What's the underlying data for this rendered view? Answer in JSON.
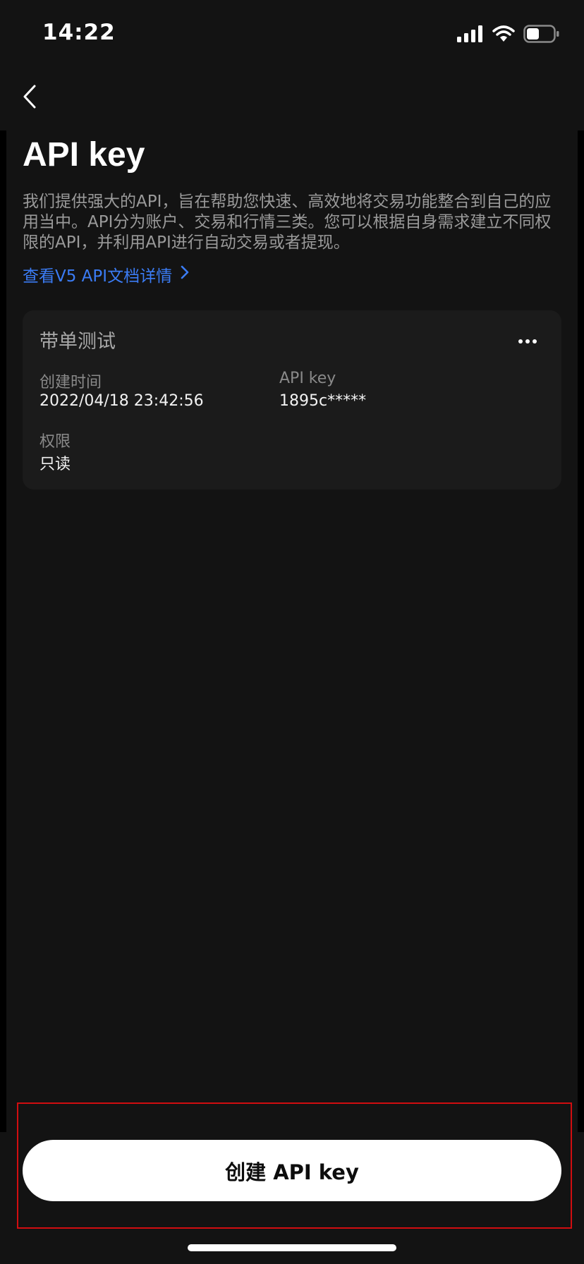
{
  "status_bar": {
    "time": "14:22"
  },
  "page": {
    "title": "API key",
    "description": "我们提供强大的API，旨在帮助您快速、高效地将交易功能整合到自己的应用当中。API分为账户、交易和行情三类。您可以根据自身需求建立不同权限的API，并利用API进行自动交易或者提现。",
    "doc_link": "查看V5 API文档详情"
  },
  "api_card": {
    "name": "带单测试",
    "created_label": "创建时间",
    "created_value": "2022/04/18 23:42:56",
    "key_label": "API key",
    "key_value": "1895c*****",
    "permission_label": "权限",
    "permission_value": "只读"
  },
  "actions": {
    "create_label": "创建 API key"
  },
  "colors": {
    "background": "#131313",
    "card": "#1b1b1b",
    "link": "#3b7cf5",
    "highlight_border": "#d10d10",
    "button": "#ffffff"
  },
  "icons": [
    "back-arrow-icon",
    "signal-icon",
    "wifi-icon",
    "battery-icon",
    "chevron-right-icon",
    "more-icon"
  ]
}
